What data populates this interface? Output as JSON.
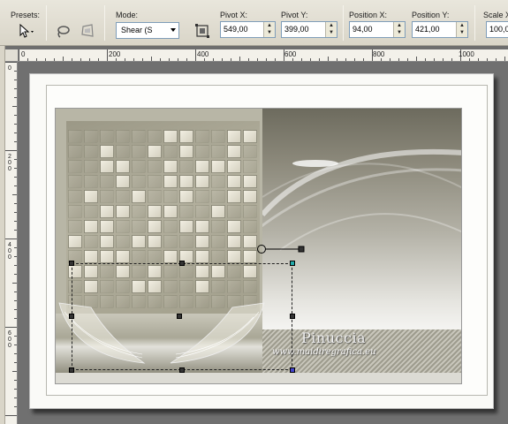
{
  "toolbar": {
    "presets_label": "Presets:",
    "mode_label": "Mode:",
    "mode_value": "Shear (S",
    "pivot_x_label": "Pivot X:",
    "pivot_x_value": "549,00",
    "pivot_y_label": "Pivot Y:",
    "pivot_y_value": "399,00",
    "position_x_label": "Position X:",
    "position_x_value": "94,00",
    "position_y_label": "Position Y:",
    "position_y_value": "421,00",
    "scale_x_label": "Scale X",
    "scale_x_value": "100,0"
  },
  "ruler": {
    "h_labels": [
      "0",
      "200",
      "400",
      "600",
      "800",
      "1000"
    ],
    "v_labels": [
      "0",
      "2\n0\n0",
      "4\n0\n0",
      "6\n0\n0"
    ]
  },
  "canvas": {
    "watermark_name": "Pinuccia",
    "watermark_url": "www.maidiregrafica.eu"
  },
  "colors": {
    "toolbar_bg": "#e2dfd5",
    "canvas_bg": "#707070",
    "sepia_dark": "#6d6b5e",
    "sepia_light": "#e6e5e0"
  },
  "icons": [
    "pick-tool-icon",
    "chevron-down-icon",
    "lasso-icon",
    "perspective-icon",
    "stretch-icon"
  ]
}
